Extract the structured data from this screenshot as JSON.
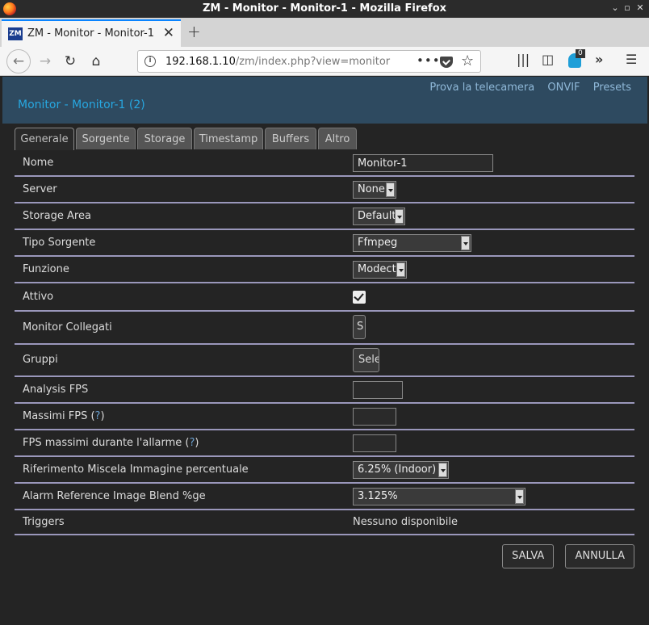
{
  "window": {
    "title": "ZM - Monitor - Monitor-1 - Mozilla Firefox",
    "minimize": "⌄",
    "maximize": "▫",
    "close": "✕"
  },
  "browser": {
    "tab_title": "ZM - Monitor - Monitor-1",
    "favicon_text": "ZM",
    "url_host": "192.168.1.10",
    "url_path": "/zm/index.php?view=monitor",
    "extension_badge": "0"
  },
  "header": {
    "links": [
      "Prova la telecamera",
      "ONVIF",
      "Presets"
    ],
    "title": "Monitor - Monitor-1 (2)"
  },
  "tabs": [
    "Generale",
    "Sorgente",
    "Storage",
    "Timestamp",
    "Buffers",
    "Altro"
  ],
  "active_tab": "Generale",
  "form": {
    "nome": {
      "label": "Nome",
      "value": "Monitor-1"
    },
    "server": {
      "label": "Server",
      "value": "None"
    },
    "storage_area": {
      "label": "Storage Area",
      "value": "Default"
    },
    "tipo_sorgente": {
      "label": "Tipo Sorgente",
      "value": "Ffmpeg"
    },
    "funzione": {
      "label": "Funzione",
      "value": "Modect"
    },
    "attivo": {
      "label": "Attivo",
      "checked": true
    },
    "monitor_collegati": {
      "label": "Monitor Collegati",
      "value": "S"
    },
    "gruppi": {
      "label": "Gruppi",
      "value": "Sele"
    },
    "analysis_fps": {
      "label": "Analysis FPS",
      "value": ""
    },
    "massimi_fps": {
      "label": "Massimi FPS",
      "help": "?",
      "value": ""
    },
    "fps_allarme": {
      "label": "FPS massimi durante l'allarme",
      "help": "?",
      "value": ""
    },
    "rif_miscela": {
      "label": "Riferimento Miscela Immagine percentuale",
      "value": "6.25% (Indoor)"
    },
    "alarm_blend": {
      "label": "Alarm Reference Image Blend %ge",
      "value": "3.125%"
    },
    "triggers": {
      "label": "Triggers",
      "value": "Nessuno disponibile"
    }
  },
  "buttons": {
    "save": "SALVA",
    "cancel": "ANNULLA"
  }
}
